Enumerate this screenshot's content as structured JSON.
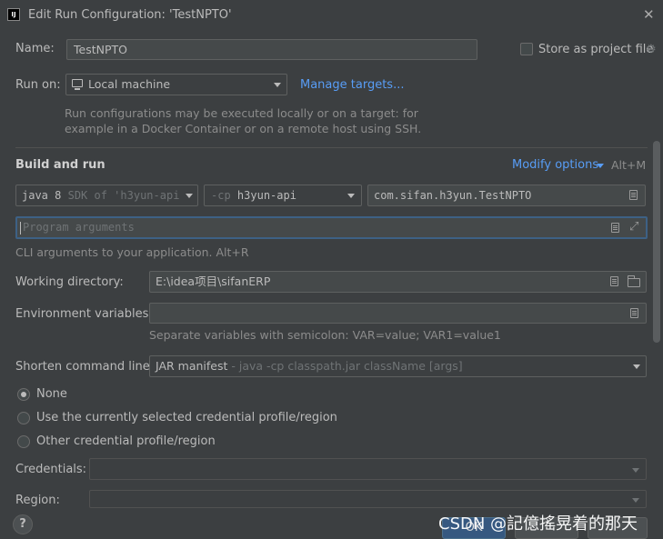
{
  "window": {
    "title": "Edit Run Configuration: 'TestNPTO'",
    "logo": "IJ"
  },
  "name_row": {
    "label": "Name:",
    "value": "TestNPTO",
    "store_label": "Store as project file",
    "store_checked": false
  },
  "run_on": {
    "label": "Run on:",
    "value": "Local machine",
    "manage_link": "Manage targets...",
    "hint_line1": "Run configurations may be executed locally or on a target: for",
    "hint_line2": "example in a Docker Container or on a remote host using SSH."
  },
  "build": {
    "title": "Build and run",
    "modify_link": "Modify options",
    "modify_shortcut": "Alt+M",
    "jdk_main": "java 8",
    "jdk_sub": "SDK of 'h3yun-api",
    "cp_prefix": "-cp",
    "cp_value": "h3yun-api",
    "main_class": "com.sifan.h3yun.TestNPTO",
    "args_placeholder": "Program arguments",
    "args_hint": "CLI arguments to your application. Alt+R"
  },
  "working_dir": {
    "label": "Working directory:",
    "value": "E:\\idea项目\\sifanERP"
  },
  "env": {
    "label": "Environment variables:",
    "value": "",
    "hint": "Separate variables with semicolon: VAR=value; VAR1=value1"
  },
  "shorten": {
    "label": "Shorten command line:",
    "value": "JAR manifest",
    "sub": "- java -cp classpath.jar className [args]"
  },
  "credentials_radios": [
    {
      "label": "None",
      "selected": true
    },
    {
      "label": "Use the currently selected credential profile/region",
      "selected": false
    },
    {
      "label": "Other credential profile/region",
      "selected": false
    }
  ],
  "credentials": {
    "label": "Credentials:"
  },
  "region": {
    "label": "Region:"
  },
  "buttons": {
    "ok": "OK",
    "help": "?"
  },
  "watermark": "CSDN @記億搖晃着的那天",
  "colors": {
    "link": "#589df6",
    "background": "#3c3f41",
    "field": "#45494a",
    "focus": "#3d6185"
  }
}
